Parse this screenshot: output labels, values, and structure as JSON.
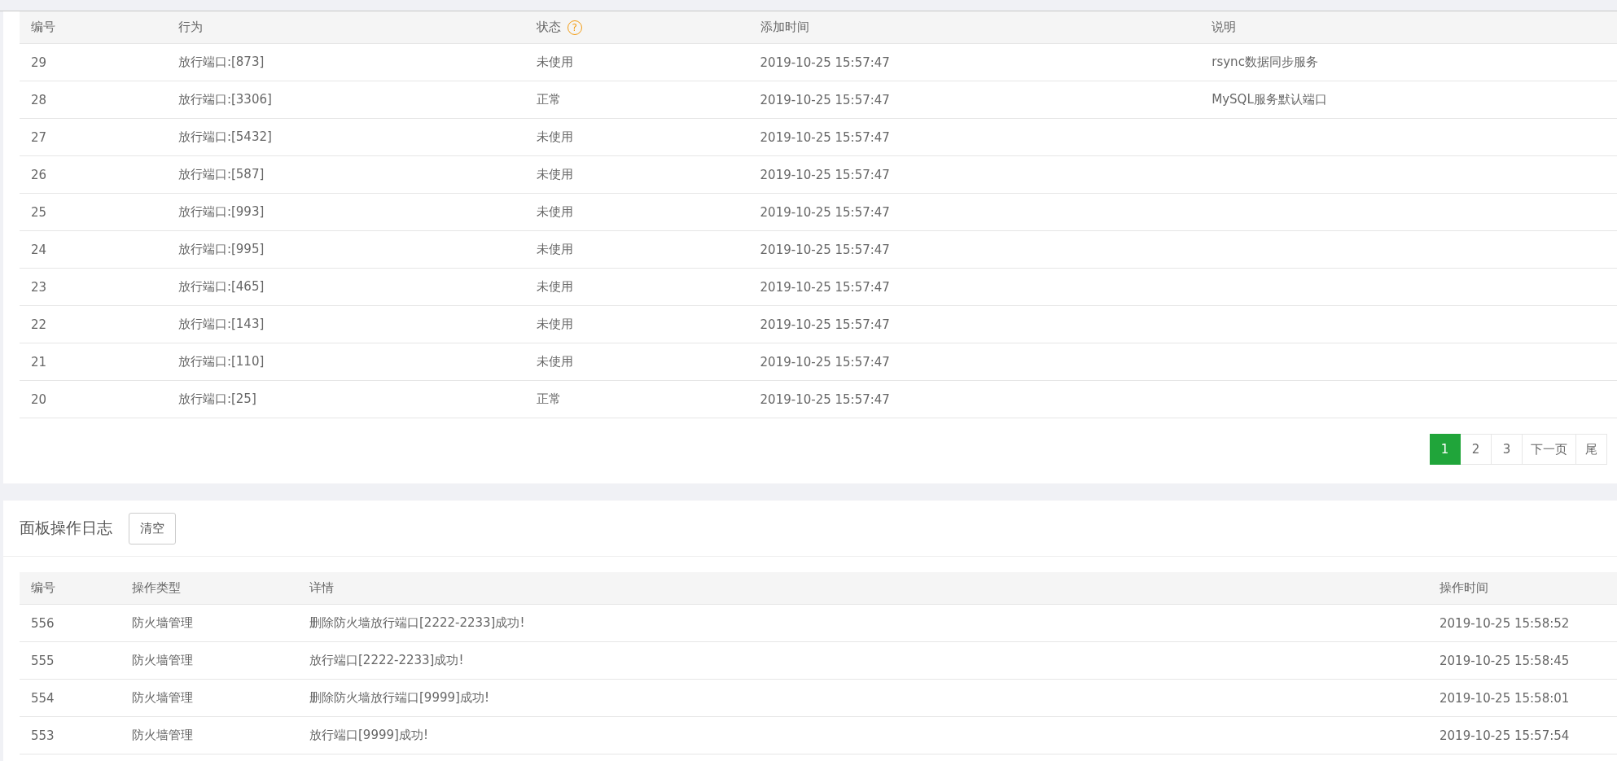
{
  "rules_table": {
    "columns": [
      {
        "label": "编号"
      },
      {
        "label": "行为"
      },
      {
        "label": "状态",
        "help_icon": "?"
      },
      {
        "label": "添加时间"
      },
      {
        "label": "说明"
      }
    ],
    "rows": [
      [
        "29",
        "放行端口:[873]",
        "未使用",
        "2019-10-25 15:57:47",
        "rsync数据同步服务"
      ],
      [
        "28",
        "放行端口:[3306]",
        "正常",
        "2019-10-25 15:57:47",
        "MySQL服务默认端口"
      ],
      [
        "27",
        "放行端口:[5432]",
        "未使用",
        "2019-10-25 15:57:47"
      ],
      [
        "26",
        "放行端口:[587]",
        "未使用",
        "2019-10-25 15:57:47"
      ],
      [
        "25",
        "放行端口:[993]",
        "未使用",
        "2019-10-25 15:57:47"
      ],
      [
        "24",
        "放行端口:[995]",
        "未使用",
        "2019-10-25 15:57:47"
      ],
      [
        "23",
        "放行端口:[465]",
        "未使用",
        "2019-10-25 15:57:47"
      ],
      [
        "22",
        "放行端口:[143]",
        "未使用",
        "2019-10-25 15:57:47"
      ],
      [
        "21",
        "放行端口:[110]",
        "未使用",
        "2019-10-25 15:57:47"
      ],
      [
        "20",
        "放行端口:[25]",
        "正常",
        "2019-10-25 15:57:47"
      ]
    ]
  },
  "pagination": [
    {
      "label": "1",
      "selected": true
    },
    {
      "label": "2",
      "selected": false
    },
    {
      "label": "3",
      "selected": false
    },
    {
      "label": "下一页",
      "selected": false
    },
    {
      "label": "尾",
      "selected": false
    }
  ],
  "log_panel": {
    "title": "面板操作日志",
    "clear_button": "清空",
    "columns": [
      {
        "label": "编号"
      },
      {
        "label": "操作类型"
      },
      {
        "label": "详情"
      },
      {
        "label": "操作时间"
      }
    ],
    "rows": [
      [
        "556",
        "防火墙管理",
        "删除防火墙放行端口[2222-2233]成功!",
        "2019-10-25 15:58:52"
      ],
      [
        "555",
        "防火墙管理",
        "放行端口[2222-2233]成功!",
        "2019-10-25 15:58:45"
      ],
      [
        "554",
        "防火墙管理",
        "删除防火墙放行端口[9999]成功!",
        "2019-10-25 15:58:01"
      ],
      [
        "553",
        "防火墙管理",
        "放行端口[9999]成功!",
        "2019-10-25 15:57:54"
      ]
    ]
  }
}
